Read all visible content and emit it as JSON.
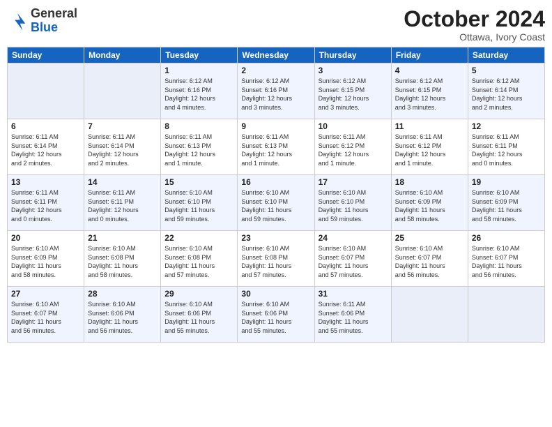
{
  "header": {
    "logo_general": "General",
    "logo_blue": "Blue",
    "month": "October 2024",
    "location": "Ottawa, Ivory Coast"
  },
  "weekdays": [
    "Sunday",
    "Monday",
    "Tuesday",
    "Wednesday",
    "Thursday",
    "Friday",
    "Saturday"
  ],
  "weeks": [
    [
      {
        "day": "",
        "info": ""
      },
      {
        "day": "",
        "info": ""
      },
      {
        "day": "1",
        "info": "Sunrise: 6:12 AM\nSunset: 6:16 PM\nDaylight: 12 hours\nand 4 minutes."
      },
      {
        "day": "2",
        "info": "Sunrise: 6:12 AM\nSunset: 6:16 PM\nDaylight: 12 hours\nand 3 minutes."
      },
      {
        "day": "3",
        "info": "Sunrise: 6:12 AM\nSunset: 6:15 PM\nDaylight: 12 hours\nand 3 minutes."
      },
      {
        "day": "4",
        "info": "Sunrise: 6:12 AM\nSunset: 6:15 PM\nDaylight: 12 hours\nand 3 minutes."
      },
      {
        "day": "5",
        "info": "Sunrise: 6:12 AM\nSunset: 6:14 PM\nDaylight: 12 hours\nand 2 minutes."
      }
    ],
    [
      {
        "day": "6",
        "info": "Sunrise: 6:11 AM\nSunset: 6:14 PM\nDaylight: 12 hours\nand 2 minutes."
      },
      {
        "day": "7",
        "info": "Sunrise: 6:11 AM\nSunset: 6:14 PM\nDaylight: 12 hours\nand 2 minutes."
      },
      {
        "day": "8",
        "info": "Sunrise: 6:11 AM\nSunset: 6:13 PM\nDaylight: 12 hours\nand 1 minute."
      },
      {
        "day": "9",
        "info": "Sunrise: 6:11 AM\nSunset: 6:13 PM\nDaylight: 12 hours\nand 1 minute."
      },
      {
        "day": "10",
        "info": "Sunrise: 6:11 AM\nSunset: 6:12 PM\nDaylight: 12 hours\nand 1 minute."
      },
      {
        "day": "11",
        "info": "Sunrise: 6:11 AM\nSunset: 6:12 PM\nDaylight: 12 hours\nand 1 minute."
      },
      {
        "day": "12",
        "info": "Sunrise: 6:11 AM\nSunset: 6:11 PM\nDaylight: 12 hours\nand 0 minutes."
      }
    ],
    [
      {
        "day": "13",
        "info": "Sunrise: 6:11 AM\nSunset: 6:11 PM\nDaylight: 12 hours\nand 0 minutes."
      },
      {
        "day": "14",
        "info": "Sunrise: 6:11 AM\nSunset: 6:11 PM\nDaylight: 12 hours\nand 0 minutes."
      },
      {
        "day": "15",
        "info": "Sunrise: 6:10 AM\nSunset: 6:10 PM\nDaylight: 11 hours\nand 59 minutes."
      },
      {
        "day": "16",
        "info": "Sunrise: 6:10 AM\nSunset: 6:10 PM\nDaylight: 11 hours\nand 59 minutes."
      },
      {
        "day": "17",
        "info": "Sunrise: 6:10 AM\nSunset: 6:10 PM\nDaylight: 11 hours\nand 59 minutes."
      },
      {
        "day": "18",
        "info": "Sunrise: 6:10 AM\nSunset: 6:09 PM\nDaylight: 11 hours\nand 58 minutes."
      },
      {
        "day": "19",
        "info": "Sunrise: 6:10 AM\nSunset: 6:09 PM\nDaylight: 11 hours\nand 58 minutes."
      }
    ],
    [
      {
        "day": "20",
        "info": "Sunrise: 6:10 AM\nSunset: 6:09 PM\nDaylight: 11 hours\nand 58 minutes."
      },
      {
        "day": "21",
        "info": "Sunrise: 6:10 AM\nSunset: 6:08 PM\nDaylight: 11 hours\nand 58 minutes."
      },
      {
        "day": "22",
        "info": "Sunrise: 6:10 AM\nSunset: 6:08 PM\nDaylight: 11 hours\nand 57 minutes."
      },
      {
        "day": "23",
        "info": "Sunrise: 6:10 AM\nSunset: 6:08 PM\nDaylight: 11 hours\nand 57 minutes."
      },
      {
        "day": "24",
        "info": "Sunrise: 6:10 AM\nSunset: 6:07 PM\nDaylight: 11 hours\nand 57 minutes."
      },
      {
        "day": "25",
        "info": "Sunrise: 6:10 AM\nSunset: 6:07 PM\nDaylight: 11 hours\nand 56 minutes."
      },
      {
        "day": "26",
        "info": "Sunrise: 6:10 AM\nSunset: 6:07 PM\nDaylight: 11 hours\nand 56 minutes."
      }
    ],
    [
      {
        "day": "27",
        "info": "Sunrise: 6:10 AM\nSunset: 6:07 PM\nDaylight: 11 hours\nand 56 minutes."
      },
      {
        "day": "28",
        "info": "Sunrise: 6:10 AM\nSunset: 6:06 PM\nDaylight: 11 hours\nand 56 minutes."
      },
      {
        "day": "29",
        "info": "Sunrise: 6:10 AM\nSunset: 6:06 PM\nDaylight: 11 hours\nand 55 minutes."
      },
      {
        "day": "30",
        "info": "Sunrise: 6:10 AM\nSunset: 6:06 PM\nDaylight: 11 hours\nand 55 minutes."
      },
      {
        "day": "31",
        "info": "Sunrise: 6:11 AM\nSunset: 6:06 PM\nDaylight: 11 hours\nand 55 minutes."
      },
      {
        "day": "",
        "info": ""
      },
      {
        "day": "",
        "info": ""
      }
    ]
  ]
}
